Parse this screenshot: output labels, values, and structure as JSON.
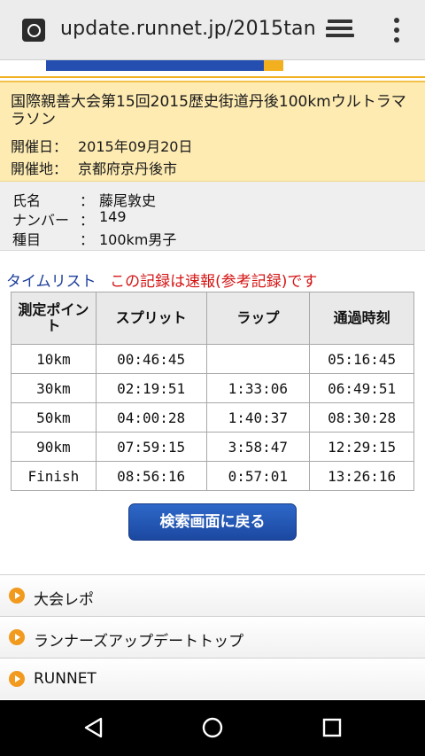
{
  "browser": {
    "url": "update.runnet.jp/2015tan"
  },
  "event": {
    "title": "国際親善大会第15回2015歴史街道丹後100kmウルトラマラソン",
    "date_label": "開催日：",
    "date_value": "2015年09月20日",
    "place_label": "開催地：",
    "place_value": "京都府京丹後市"
  },
  "runner": {
    "rows": [
      {
        "label": "氏名",
        "colon": "：",
        "value": "藤尾敦史"
      },
      {
        "label": "ナンバー",
        "colon": "：",
        "value": "149"
      },
      {
        "label": "種目",
        "colon": "：",
        "value": "100km男子"
      }
    ]
  },
  "timelist": {
    "title": "タイムリスト",
    "note": "この記録は速報(参考記録)です"
  },
  "table": {
    "headers": [
      "測定ポイント",
      "スプリット",
      "ラップ",
      "通過時刻"
    ],
    "rows": [
      [
        "10km",
        "00:46:45",
        "",
        "05:16:45"
      ],
      [
        "30km",
        "02:19:51",
        "1:33:06",
        "06:49:51"
      ],
      [
        "50km",
        "04:00:28",
        "1:40:37",
        "08:30:28"
      ],
      [
        "90km",
        "07:59:15",
        "3:58:47",
        "12:29:15"
      ],
      [
        "Finish",
        "08:56:16",
        "0:57:01",
        "13:26:16"
      ]
    ]
  },
  "back_button": "検索画面に戻る",
  "links": [
    {
      "label": "大会レポ"
    },
    {
      "label": "ランナーズアップデートトップ"
    },
    {
      "label": "RUNNET"
    }
  ],
  "icons": {
    "site": "globe-icon",
    "tabs": "tabs-icon",
    "menu": "more-vert-icon",
    "link": "arrow-right-circle-icon",
    "nav": [
      "back-triangle-icon",
      "home-circle-icon",
      "recents-square-icon"
    ]
  },
  "colors": {
    "event_bg": "#fdebb2",
    "timelist_title": "#1f3f9c",
    "timelist_note": "#d41414",
    "button": "#1b48a0",
    "link_arrow": "#f29a1e"
  }
}
